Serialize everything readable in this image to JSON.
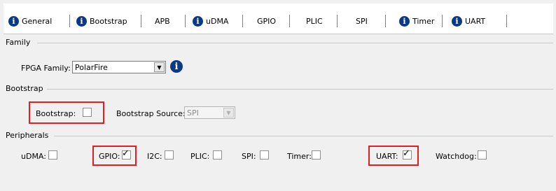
{
  "tabs": [
    {
      "label": "General",
      "icon": "info-icon"
    },
    {
      "label": "Bootstrap",
      "icon": "info-icon"
    },
    {
      "label": "APB"
    },
    {
      "label": "uDMA",
      "icon": "info-icon"
    },
    {
      "label": "GPIO"
    },
    {
      "label": "PLIC"
    },
    {
      "label": "SPI"
    },
    {
      "label": "Timer",
      "icon": "info-icon"
    },
    {
      "label": "UART",
      "icon": "info-icon"
    }
  ],
  "family": {
    "title": "Family",
    "fpga_label": "FPGA Family:",
    "fpga_value": "PolarFire",
    "info_icon": "info-icon"
  },
  "bootstrap": {
    "title": "Bootstrap",
    "bootstrap_label": "Bootstrap:",
    "bootstrap_checked": false,
    "source_label": "Bootstrap Source:",
    "source_value": "SPI"
  },
  "peripherals": {
    "title": "Peripherals",
    "items": [
      {
        "label": "uDMA:",
        "checked": false
      },
      {
        "label": "GPIO:",
        "checked": true
      },
      {
        "label": "I2C:",
        "checked": false
      },
      {
        "label": "PLIC:",
        "checked": false
      },
      {
        "label": "SPI:",
        "checked": false
      },
      {
        "label": "Timer:",
        "checked": false
      },
      {
        "label": "UART:",
        "checked": true
      },
      {
        "label": "Watchdog:",
        "checked": false
      }
    ]
  },
  "colors": {
    "highlight": "#e02020",
    "info_icon": "#0a3a86"
  }
}
